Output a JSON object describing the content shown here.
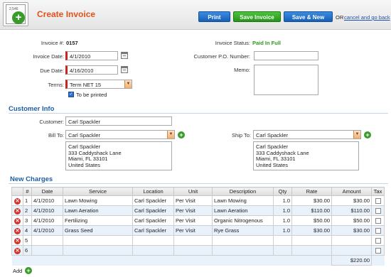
{
  "header": {
    "title": "Create Invoice",
    "logo_text": "2,546",
    "print_label": "Print",
    "save_label": "Save Invoice",
    "save_new_label": "Save & New",
    "or_text": "OR",
    "cancel_label": "cancel and go back"
  },
  "invoice": {
    "number_label": "Invoice #:",
    "number": "0157",
    "status_label": "Invoice Status:",
    "status": "Paid In Full",
    "date_label": "Invoice Date:",
    "date": "4/1/2010",
    "due_label": "Due Date:",
    "due": "4/16/2010",
    "terms_label": "Terms:",
    "terms": "Term NET 15",
    "print_label": "To be printed",
    "po_label": "Customer P.O. Number:",
    "po": "",
    "memo_label": "Memo:",
    "memo": ""
  },
  "customer": {
    "section": "Customer Info",
    "customer_label": "Customer:",
    "customer": "Carl Spackler",
    "billto_label": "Bill To:",
    "billto": "Carl Spackler",
    "shipto_label": "Ship To:",
    "shipto": "Carl Spackler",
    "bill_address": [
      "Carl Spackler",
      "333 Caddyshack Lane",
      "Miami, FL 33101",
      "United States"
    ],
    "ship_address": [
      "Carl Spackler",
      "333 Caddyshack Lane",
      "Miami, FL 33101",
      "United States"
    ]
  },
  "charges": {
    "section": "New Charges",
    "columns": [
      "#",
      "Date",
      "Service",
      "Location",
      "Unit",
      "Description",
      "Qty",
      "Rate",
      "Amount",
      "Tax"
    ],
    "rows": [
      {
        "n": "1",
        "date": "4/1/2010",
        "service": "Lawn Mowing",
        "location": "Carl Spackler",
        "unit": "Per Visit",
        "desc": "Lawn Mowing",
        "qty": "1.0",
        "rate": "$30.00",
        "amount": "$30.00"
      },
      {
        "n": "2",
        "date": "4/1/2010",
        "service": "Lawn Aeration",
        "location": "Carl Spackler",
        "unit": "Per Visit",
        "desc": "Lawn Aeration",
        "qty": "1.0",
        "rate": "$110.00",
        "amount": "$110.00"
      },
      {
        "n": "3",
        "date": "4/1/2010",
        "service": "Fertilizing",
        "location": "Carl Spackler",
        "unit": "Per Visit",
        "desc": "Organic Nitrogenous",
        "qty": "1.0",
        "rate": "$50.00",
        "amount": "$50.00"
      },
      {
        "n": "4",
        "date": "4/1/2010",
        "service": "Grass Seed",
        "location": "Carl Spackler",
        "unit": "Per Visit",
        "desc": "Rye Grass",
        "qty": "1.0",
        "rate": "$30.00",
        "amount": "$30.00"
      },
      {
        "n": "5",
        "date": "",
        "service": "",
        "location": "",
        "unit": "",
        "desc": "",
        "qty": "",
        "rate": "",
        "amount": ""
      },
      {
        "n": "6",
        "date": "",
        "service": "",
        "location": "",
        "unit": "",
        "desc": "",
        "qty": "",
        "rate": "",
        "amount": ""
      }
    ],
    "total": "$220.00",
    "add_label": "Add"
  },
  "colors": {
    "accent": "#e0531b",
    "section": "#1d5ea8",
    "status": "#2a9a1a"
  }
}
